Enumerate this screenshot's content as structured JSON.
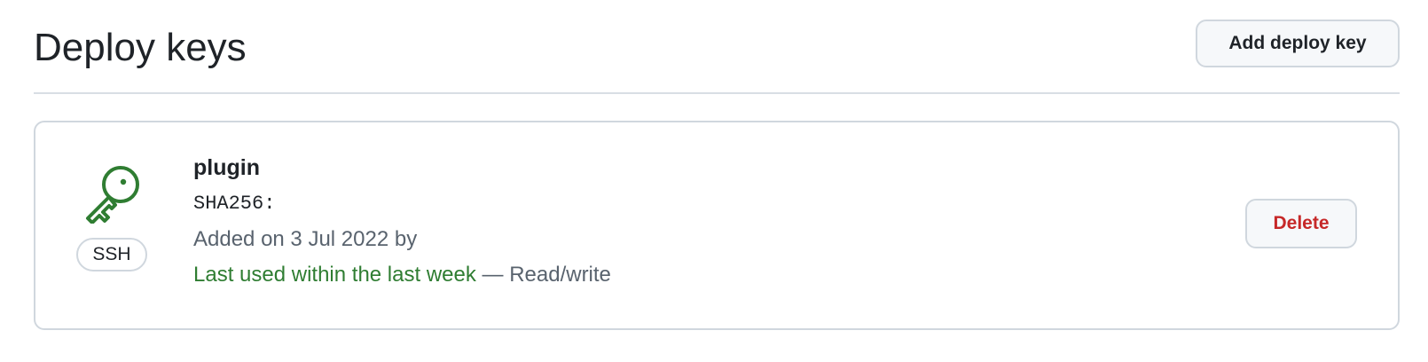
{
  "header": {
    "title": "Deploy keys",
    "add_button_label": "Add deploy key"
  },
  "deploy_keys": [
    {
      "title": "plugin",
      "type_badge": "SSH",
      "fingerprint_label": "SHA256:",
      "added_text": "Added on 3 Jul 2022 by",
      "last_used_text": "Last used within the last week",
      "separator": " — ",
      "access_text": "Read/write",
      "delete_label": "Delete",
      "icon": "key-icon"
    }
  ],
  "colors": {
    "key_icon": "#2f7d32",
    "last_used": "#2f7d32",
    "delete_text": "#c62828",
    "border": "#d0d7de"
  }
}
